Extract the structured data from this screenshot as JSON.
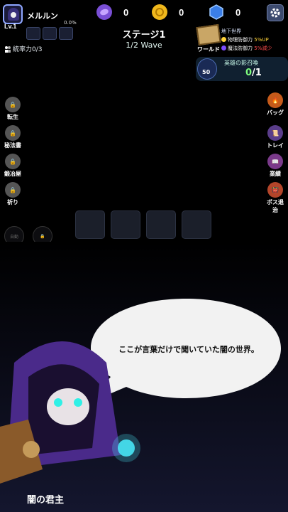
{
  "player": {
    "name": "メルルン",
    "level": "Lv.1",
    "exp_percent": "0.0%",
    "command_label": "統率力",
    "command_value": "0/3"
  },
  "currencies": [
    {
      "name": "orb",
      "value": "0",
      "color": "#7a4fd6"
    },
    {
      "name": "coin",
      "value": "0",
      "color": "#f0b81c"
    },
    {
      "name": "gem",
      "value": "0",
      "color": "#3a7ee8"
    }
  ],
  "stage": {
    "title": "ステージ1",
    "wave": "1/2 Wave"
  },
  "world": {
    "label": "ワールド",
    "area": "地下世界",
    "phys": "物理防御力",
    "phys_mod": "5%UP",
    "magic": "魔法防御力",
    "magic_mod": "5%減少"
  },
  "summon": {
    "title": "英雄の影召喚",
    "gem_count": "50",
    "current": "0",
    "max": "1"
  },
  "left_menu": [
    "転生",
    "秘法書",
    "鍛冶屋",
    "祈り"
  ],
  "right_menu": [
    "バッグ",
    "トレイ",
    "業績",
    "ボス退治"
  ],
  "auto_label": "自動",
  "dialog": {
    "text": "ここが言葉だけで聞いていた闇の世界。",
    "speaker": "闇の君主"
  },
  "colors": {
    "accent": "#2fd9c7",
    "bubble": "#f2f2f2"
  }
}
